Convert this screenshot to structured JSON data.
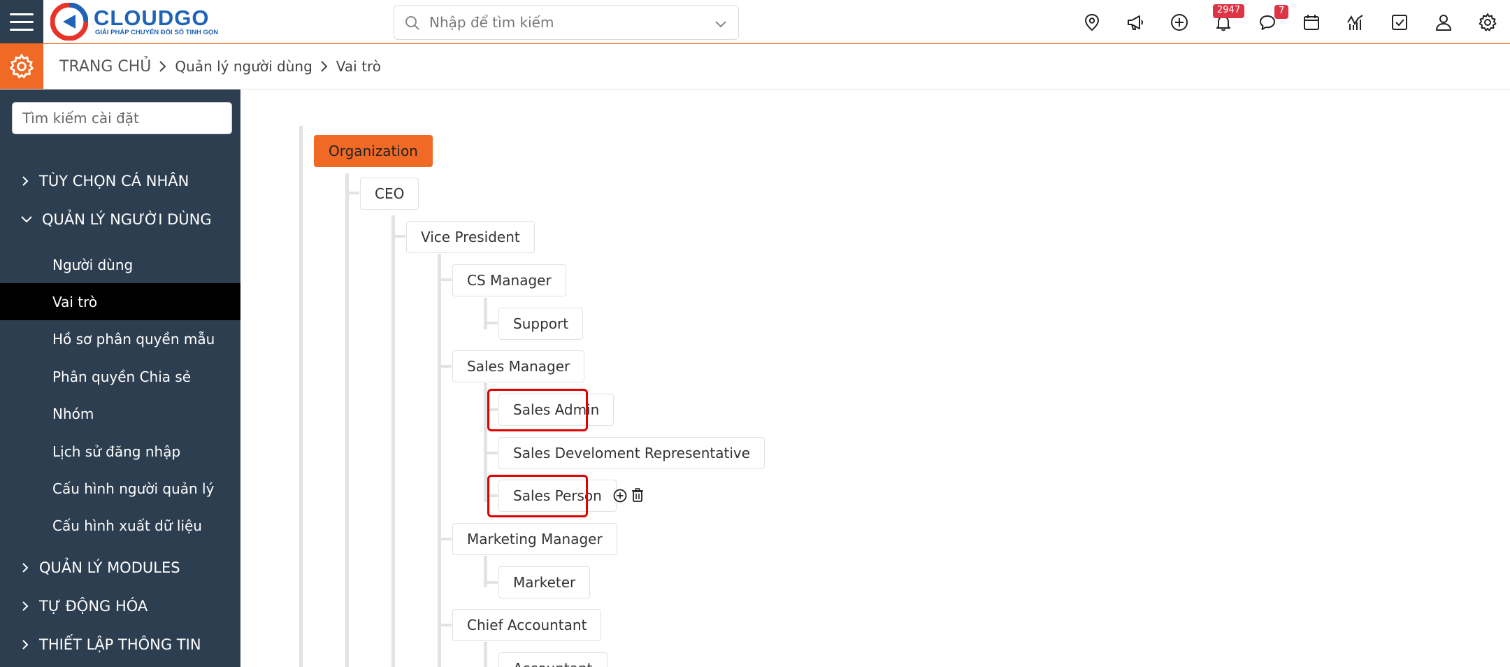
{
  "header": {
    "brand_name": "CLOUDGO",
    "brand_tagline": "GIẢI PHÁP CHUYỂN ĐỔI SỐ TINH GỌN",
    "search_placeholder": "Nhập để tìm kiếm",
    "notifications_count": "2947",
    "messages_count": "7",
    "icons": [
      "map-pin-icon",
      "megaphone-icon",
      "plus-circle-icon",
      "bell-icon",
      "chat-icon",
      "calendar-icon",
      "chart-icon",
      "checkbox-icon",
      "user-icon",
      "gear-icon"
    ]
  },
  "breadcrumb": {
    "home": "TRANG CHỦ",
    "level1": "Quản lý người dùng",
    "level2": "Vai trò"
  },
  "sidebar": {
    "search_placeholder": "Tìm kiếm cài đặt",
    "sections": [
      {
        "label": "TÙY CHỌN CÁ NHÂN",
        "expanded": false
      },
      {
        "label": "QUẢN LÝ NGƯỜI DÙNG",
        "expanded": true
      },
      {
        "label": "QUẢN LÝ MODULES",
        "expanded": false
      },
      {
        "label": "TỰ ĐỘNG HÓA",
        "expanded": false
      },
      {
        "label": "THIẾT LẬP THÔNG TIN",
        "expanded": false
      }
    ],
    "user_mgmt_items": [
      {
        "label": "Người dùng"
      },
      {
        "label": "Vai trò",
        "active": true
      },
      {
        "label": "Hồ sơ phân quyền mẫu"
      },
      {
        "label": "Phân quyền Chia sẻ"
      },
      {
        "label": "Nhóm"
      },
      {
        "label": "Lịch sử đăng nhập"
      },
      {
        "label": "Cấu hình người quản lý"
      },
      {
        "label": "Cấu hình xuất dữ liệu"
      }
    ]
  },
  "tree": {
    "root": "Organization",
    "ceo": "CEO",
    "vp": "Vice President",
    "cs_manager": "CS Manager",
    "support": "Support",
    "sales_manager": "Sales Manager",
    "sales_admin": "Sales Admin",
    "sales_dev_rep": "Sales Develoment Representative",
    "sales_person": "Sales Person",
    "marketing_manager": "Marketing Manager",
    "marketer": "Marketer",
    "chief_accountant": "Chief Accountant",
    "accountant": "Accountant"
  },
  "colors": {
    "sidebar_bg": "#2c3e50",
    "accent": "#f06a25",
    "active_item": "#000000",
    "badge": "#dc3545",
    "highlight": "#e00000",
    "brand": "#1e63b8"
  }
}
